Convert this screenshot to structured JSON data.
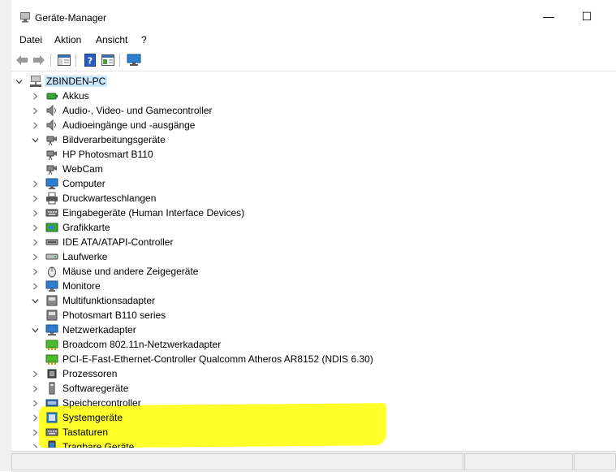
{
  "window": {
    "title": "Geräte-Manager"
  },
  "titlebar": {
    "minimize": "—",
    "maximize": "☐"
  },
  "menu": [
    "Datei",
    "Aktion",
    "Ansicht",
    "?"
  ],
  "tree": {
    "root": "ZBINDEN-PC",
    "nodes": [
      {
        "label": "Akkus",
        "state": "collapsed",
        "icon": "battery-icon"
      },
      {
        "label": "Audio-, Video- und Gamecontroller",
        "state": "collapsed",
        "icon": "speaker-icon"
      },
      {
        "label": "Audioeingänge und -ausgänge",
        "state": "collapsed",
        "icon": "speaker-icon"
      },
      {
        "label": "Bildverarbeitungsgeräte",
        "state": "expanded",
        "icon": "camera-icon"
      },
      {
        "label": "HP Photosmart B110",
        "state": "child",
        "icon": "camera-icon"
      },
      {
        "label": "WebCam",
        "state": "child",
        "icon": "camera-icon"
      },
      {
        "label": "Computer",
        "state": "collapsed",
        "icon": "monitor-icon"
      },
      {
        "label": "Druckwarteschlangen",
        "state": "collapsed",
        "icon": "printer-icon"
      },
      {
        "label": "Eingabegeräte (Human Interface Devices)",
        "state": "collapsed",
        "icon": "keyboard-icon"
      },
      {
        "label": "Grafikkarte",
        "state": "collapsed",
        "icon": "gpu-icon"
      },
      {
        "label": "IDE ATA/ATAPI-Controller",
        "state": "collapsed",
        "icon": "ide-icon"
      },
      {
        "label": "Laufwerke",
        "state": "collapsed",
        "icon": "drive-icon"
      },
      {
        "label": "Mäuse und andere Zeigegeräte",
        "state": "collapsed",
        "icon": "mouse-icon"
      },
      {
        "label": "Monitore",
        "state": "collapsed",
        "icon": "monitor-icon"
      },
      {
        "label": "Multifunktionsadapter",
        "state": "expanded",
        "icon": "multifunction-icon"
      },
      {
        "label": "Photosmart B110 series",
        "state": "child",
        "icon": "multifunction-icon"
      },
      {
        "label": "Netzwerkadapter",
        "state": "expanded",
        "icon": "network-icon"
      },
      {
        "label": "Broadcom 802.11n-Netzwerkadapter",
        "state": "child",
        "icon": "network-card-icon"
      },
      {
        "label": "PCI-E-Fast-Ethernet-Controller Qualcomm Atheros AR8152 (NDIS 6.30)",
        "state": "child",
        "icon": "network-card-icon"
      },
      {
        "label": "Prozessoren",
        "state": "collapsed",
        "icon": "cpu-icon"
      },
      {
        "label": "Softwaregeräte",
        "state": "collapsed",
        "icon": "software-device-icon"
      },
      {
        "label": "Speichercontroller",
        "state": "collapsed",
        "icon": "storage-icon"
      },
      {
        "label": "Systemgeräte",
        "state": "collapsed",
        "icon": "system-icon"
      },
      {
        "label": "Tastaturen",
        "state": "collapsed",
        "icon": "keyboard-icon"
      },
      {
        "label": "Tragbare Geräte",
        "state": "collapsed",
        "icon": "portable-icon"
      }
    ]
  },
  "colors": {
    "selection": "#cce8ff",
    "highlight": "#ffff2a"
  }
}
